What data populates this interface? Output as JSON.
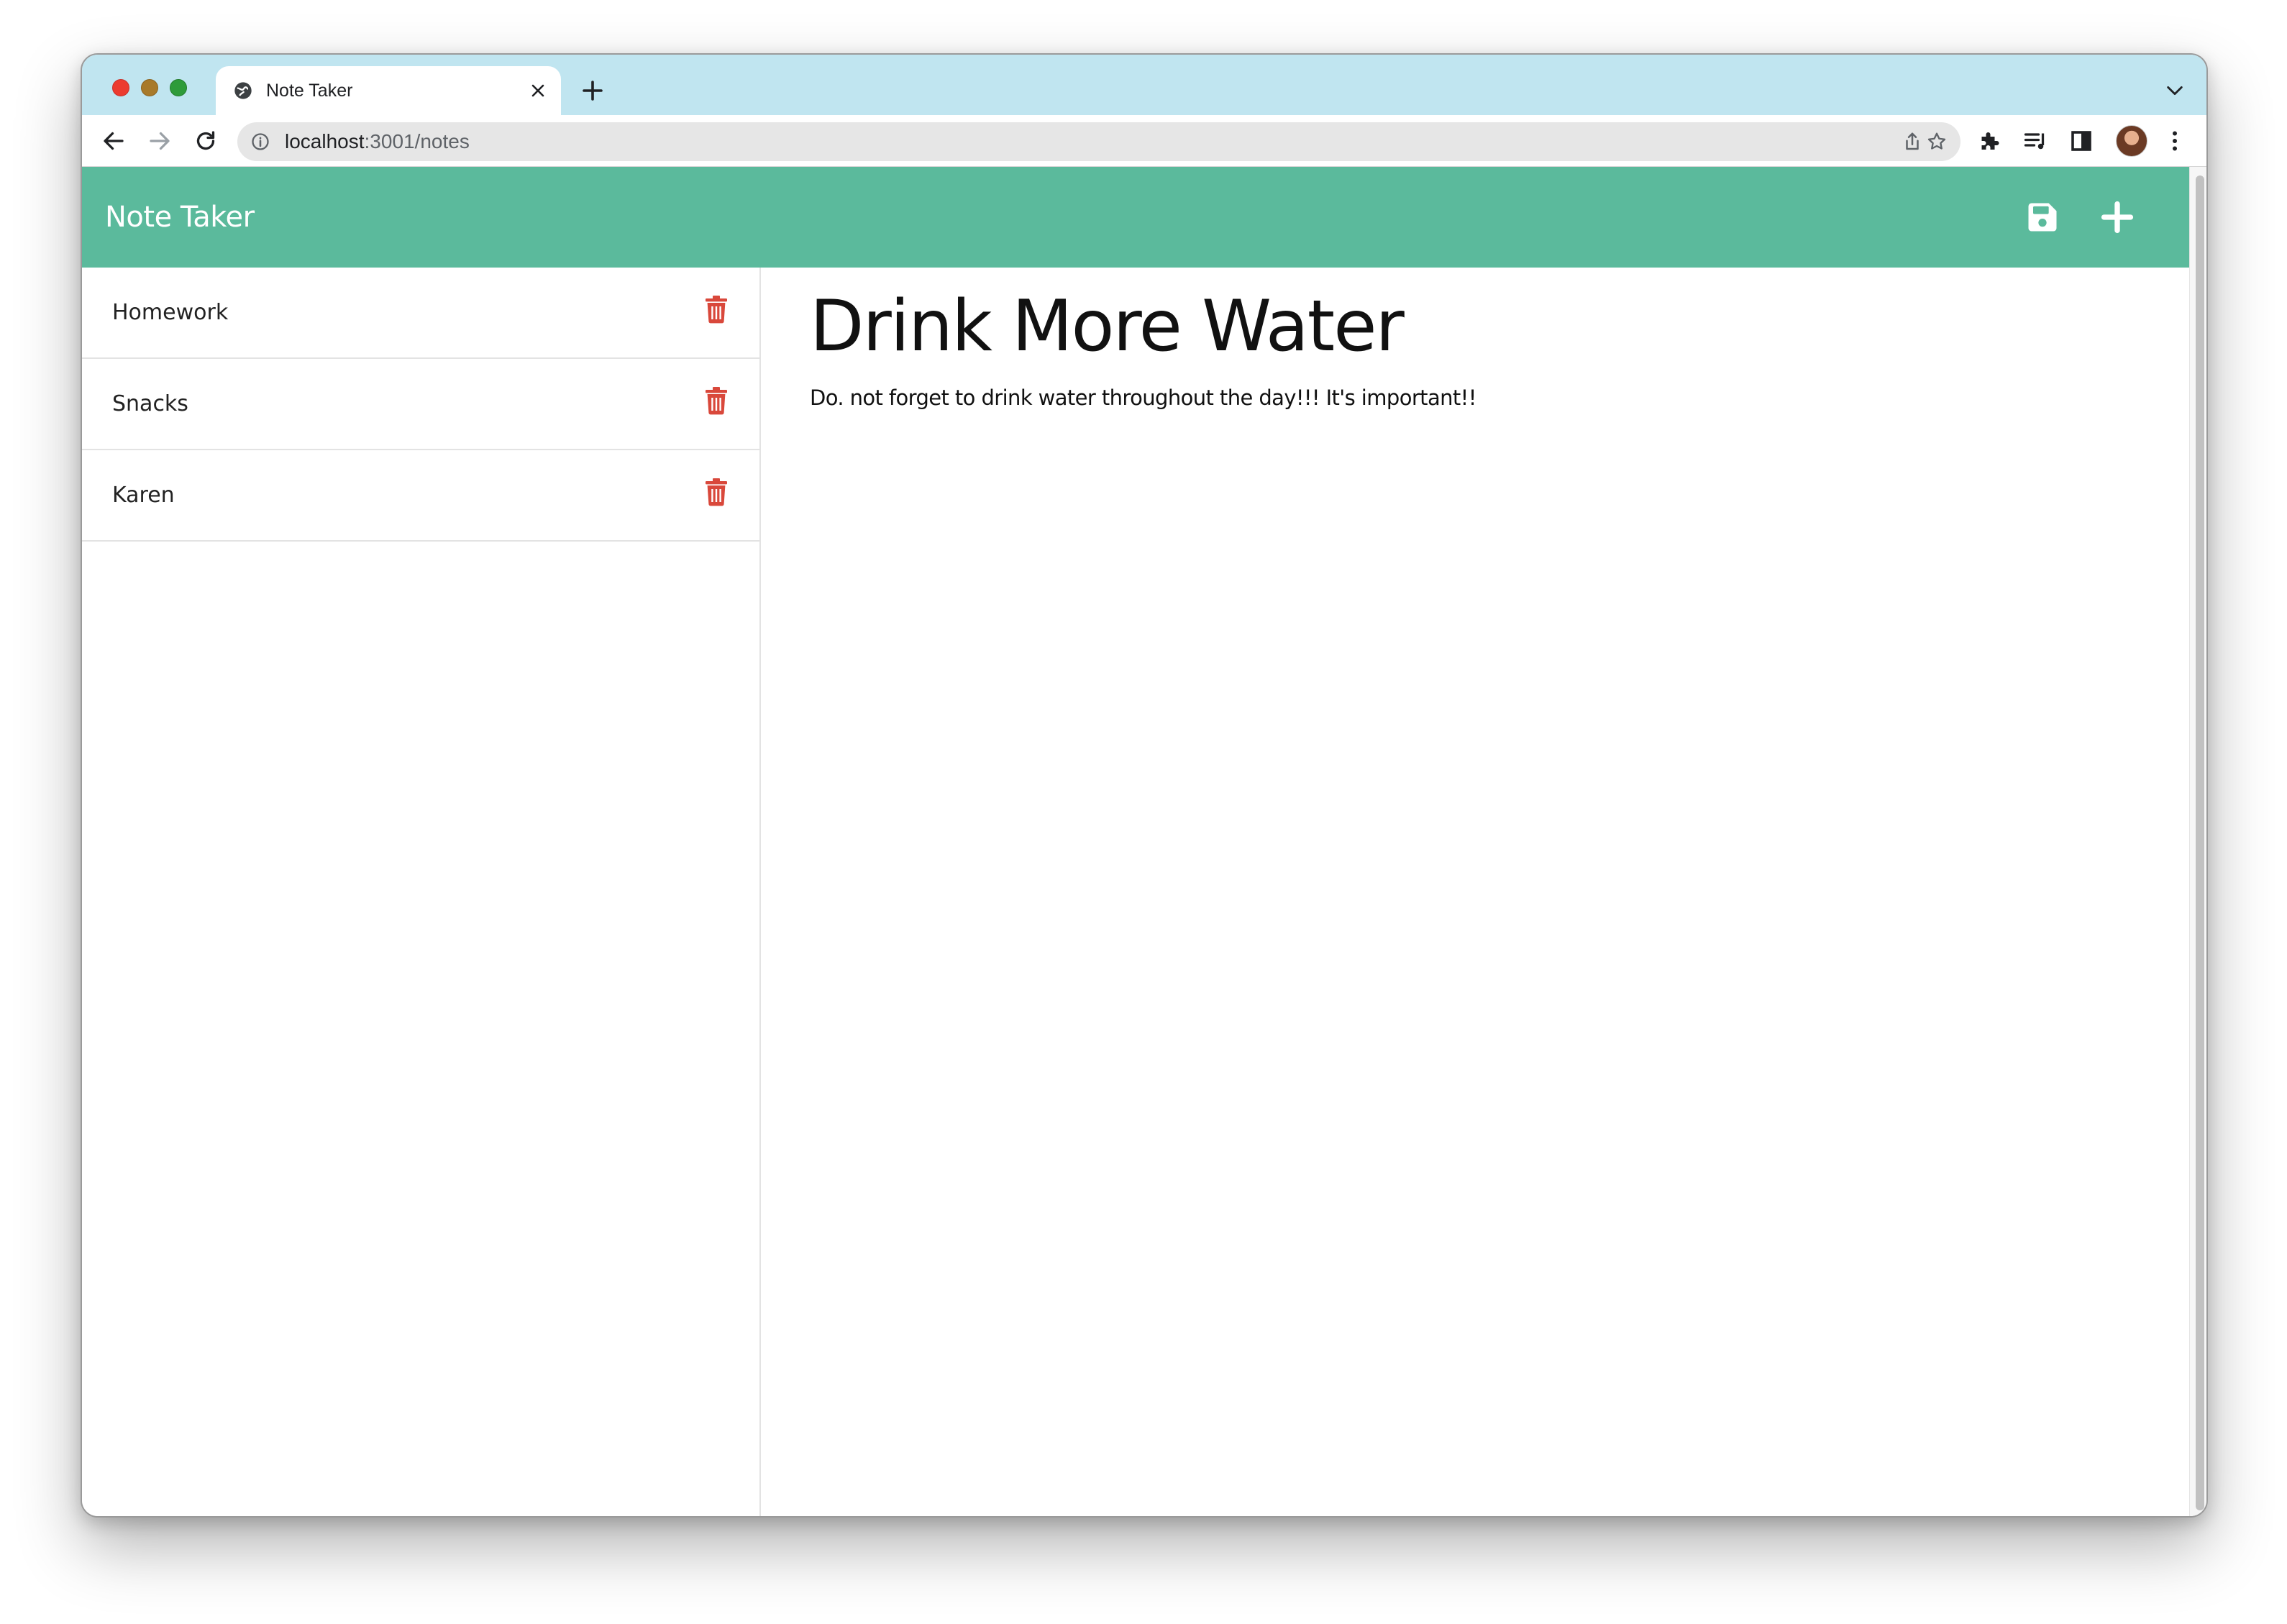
{
  "browser": {
    "tab": {
      "title": "Note Taker",
      "icon": "globe-icon"
    },
    "address": {
      "host": "localhost",
      "rest": ":3001/notes"
    }
  },
  "app": {
    "brand": "Note Taker",
    "actions": {
      "save_icon": "floppy-disk-icon",
      "new_icon": "plus-icon"
    },
    "notes": [
      {
        "title": "Homework"
      },
      {
        "title": "Snacks"
      },
      {
        "title": "Karen"
      }
    ],
    "active_note": {
      "title": "Drink More Water",
      "text": "Do. not forget to drink water throughout the day!!! It's important!!"
    },
    "colors": {
      "navbar": "#5bba9c",
      "delete": "#d9483b"
    }
  }
}
